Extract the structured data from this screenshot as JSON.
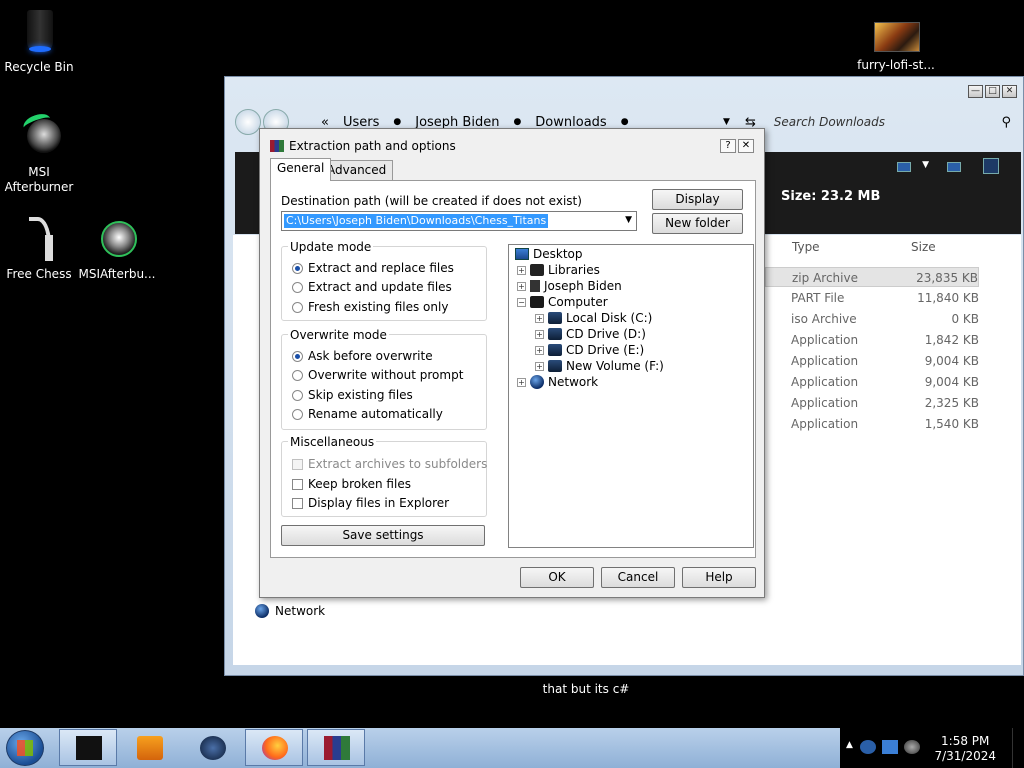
{
  "desktop": {
    "icons": [
      {
        "label": "Recycle Bin",
        "icon": "recycle-bin-icon"
      },
      {
        "label": "MSI Afterburner",
        "icon": "msi-afterburner-icon"
      },
      {
        "label": "Free Chess",
        "icon": "free-chess-icon"
      },
      {
        "label": "MSIAfterbu...",
        "icon": "msi-afterburner-shortcut-icon"
      },
      {
        "label": "furry-lofi-st...",
        "icon": "image-file-icon"
      }
    ]
  },
  "explorer": {
    "breadcrumb": [
      "Users",
      "Joseph Biden",
      "Downloads"
    ],
    "breadcrumb_prefix": "«",
    "search_placeholder": "Search Downloads",
    "size_label": "Size: 23.2 MB",
    "columns": {
      "type": "Type",
      "size": "Size"
    },
    "files": [
      {
        "type": "zip Archive",
        "size": "23,835 KB",
        "selected": true
      },
      {
        "type": "PART File",
        "size": "11,840 KB"
      },
      {
        "type": "iso Archive",
        "size": "0 KB"
      },
      {
        "type": "Application",
        "size": "1,842 KB"
      },
      {
        "type": "Application",
        "size": "9,004 KB"
      },
      {
        "type": "Application",
        "size": "9,004 KB"
      },
      {
        "type": "Application",
        "size": "2,325 KB"
      },
      {
        "type": "Application",
        "size": "1,540 KB"
      }
    ],
    "network_label": "Network"
  },
  "dialog": {
    "title": "Extraction path and options",
    "tabs": [
      "General",
      "Advanced"
    ],
    "dest_label": "Destination path (will be created if does not exist)",
    "dest_value": "C:\\Users\\Joseph Biden\\Downloads\\Chess_Titans",
    "display_button": "Display",
    "new_folder_button": "New folder",
    "update_mode": {
      "title": "Update mode",
      "options": [
        "Extract and replace files",
        "Extract and update files",
        "Fresh existing files only"
      ],
      "selected": 0
    },
    "overwrite_mode": {
      "title": "Overwrite mode",
      "options": [
        "Ask before overwrite",
        "Overwrite without prompt",
        "Skip existing files",
        "Rename automatically"
      ],
      "selected": 0
    },
    "misc": {
      "title": "Miscellaneous",
      "options": [
        "Extract archives to subfolders",
        "Keep broken files",
        "Display files in Explorer"
      ]
    },
    "save_settings": "Save settings",
    "tree": [
      {
        "label": "Desktop",
        "icon": "desktop-folder-icon"
      },
      {
        "label": "Libraries",
        "icon": "libraries-icon"
      },
      {
        "label": "Joseph Biden",
        "icon": "user-folder-icon"
      },
      {
        "label": "Computer",
        "icon": "computer-icon"
      },
      {
        "label": "Local Disk (C:)",
        "icon": "hard-disk-icon"
      },
      {
        "label": "CD Drive (D:)",
        "icon": "cd-drive-icon"
      },
      {
        "label": "CD Drive (E:)",
        "icon": "cd-drive-icon"
      },
      {
        "label": "New Volume (F:)",
        "icon": "hard-disk-icon"
      },
      {
        "label": "Network",
        "icon": "network-icon"
      }
    ],
    "ok": "OK",
    "cancel": "Cancel",
    "help": "Help"
  },
  "caption": "that but its c#",
  "taskbar": {
    "time": "1:58 PM",
    "date": "7/31/2024"
  }
}
